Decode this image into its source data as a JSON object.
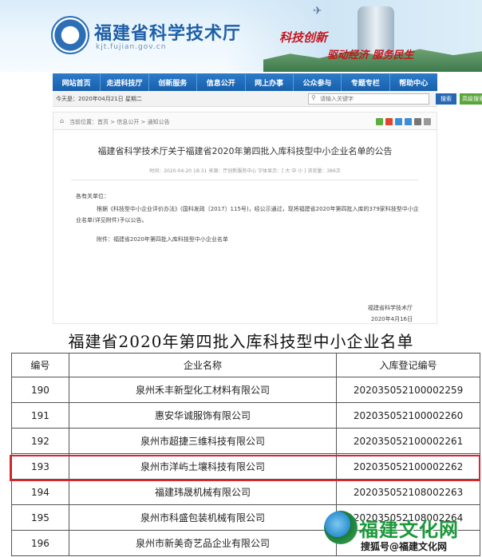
{
  "header": {
    "site_title": "福建省科学技术厅",
    "site_url": "kjt.fujian.gov.cn",
    "slogan_1": "科技创新",
    "slogan_2": "驱动经济 服务民生"
  },
  "nav": {
    "items": [
      "网站首页",
      "走进科技厅",
      "创新服务",
      "信息公开",
      "网上办事",
      "公众参与",
      "专题专栏",
      "帮助中心"
    ]
  },
  "datebar": {
    "date_text": "今天是：2020年04月21日  星期二",
    "search_placeholder": "请输入关键字",
    "search_label": "搜索",
    "advanced_label": "高级搜索"
  },
  "article": {
    "breadcrumb": "当前位置：首页 > 信息公开 > 通知公告",
    "title": "福建省科学技术厅关于福建省2020年第四批入库科技型中小企业名单的公告",
    "meta": "时间：2020-04-20 18:31    来源：厅创新服务中心    字体显示：[ 大 中 小 ]    浏览量：386次",
    "salutation": "各有关单位：",
    "para_1": "根据《科技型中小企业评价办法》(国科发政〔2017〕115号)，经公示通过，现将福建省2020年第四批入库的379家科技型中小企业名单(详见附件)予以公告。",
    "attachment": "附件：福建省2020年第四批入库科技型中小企业名单",
    "signature_org": "福建省科学技术厅",
    "signature_date": "2020年4月16日"
  },
  "list": {
    "title": "福建省2020年第四批入库科技型中小企业名单",
    "columns": [
      "编号",
      "企业名称",
      "入库登记编号"
    ],
    "rows": [
      {
        "no": "190",
        "name": "泉州禾丰新型化工材料有限公司",
        "code": "202035052100002259"
      },
      {
        "no": "191",
        "name": "惠安华诚服饰有限公司",
        "code": "202035052100002260"
      },
      {
        "no": "192",
        "name": "泉州市超捷三维科技有限公司",
        "code": "202035052100002261"
      },
      {
        "no": "193",
        "name": "泉州市洋屿土壤科技有限公司",
        "code": "202035052100002262"
      },
      {
        "no": "194",
        "name": "福建玮晟机械有限公司",
        "code": "202035052108002263"
      },
      {
        "no": "195",
        "name": "泉州市科盛包装机械有限公司",
        "code": "202035052108002264"
      },
      {
        "no": "196",
        "name": "泉州市新美奇艺品企业有限公司",
        "code": ""
      }
    ],
    "highlight_row": "193"
  },
  "watermark": {
    "title": "福建文化网",
    "subtitle": "搜狐号@福建文化网"
  },
  "colors": {
    "nav_blue": "#1760ad",
    "highlight_red": "#d9262c",
    "watermark_green": "#1a9a3a"
  }
}
